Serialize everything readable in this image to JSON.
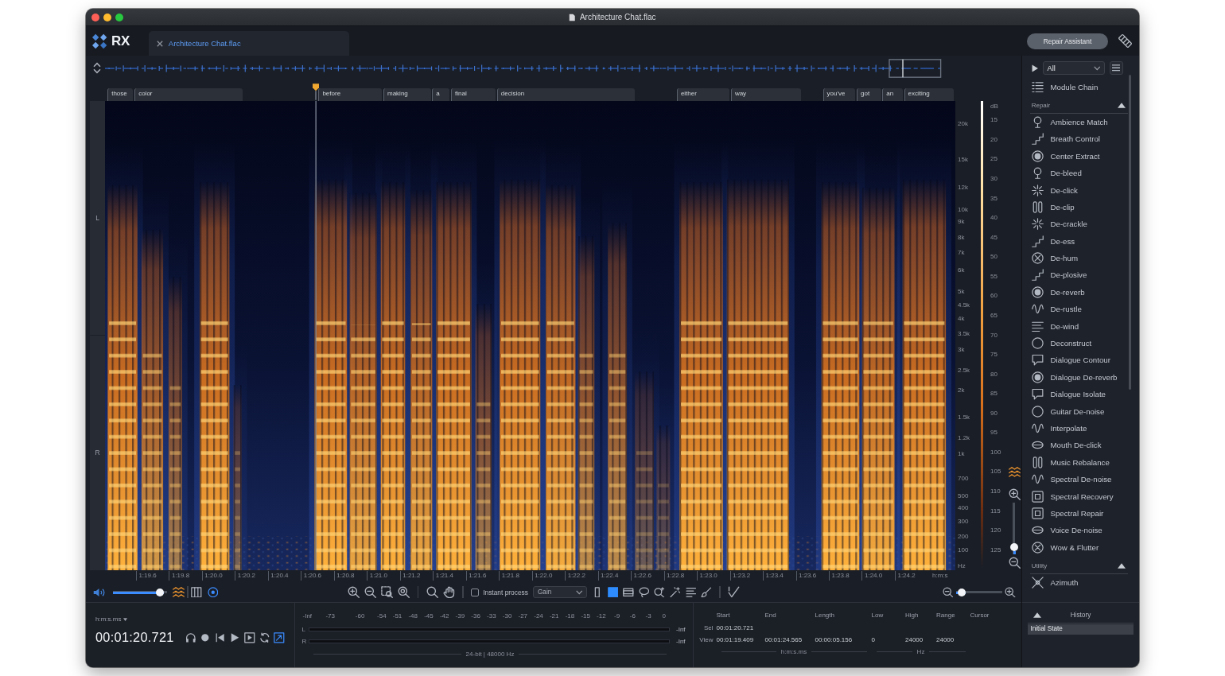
{
  "window": {
    "title": "Architecture Chat.flac"
  },
  "logo": "RX",
  "tabs": [
    {
      "label": "Architecture Chat.flac",
      "selected": true
    }
  ],
  "repair_assistant": "Repair Assistant",
  "transcript": [
    "those",
    "color",
    "before",
    "making",
    "a",
    "final",
    "decision",
    "either",
    "way",
    "you've",
    "got",
    "an",
    "exciting"
  ],
  "spectrogram": {
    "channels": [
      "L",
      "R"
    ],
    "frequency_labels": [
      "20k",
      "15k",
      "12k",
      "10k",
      "9k",
      "8k",
      "7k",
      "6k",
      "5k",
      "4.5k",
      "4k",
      "3.5k",
      "3k",
      "2.5k",
      "2k",
      "1.5k",
      "1.2k",
      "1k",
      "700",
      "500",
      "400",
      "300",
      "200",
      "100",
      "Hz"
    ],
    "db_labels": [
      "dB",
      "15",
      "20",
      "25",
      "30",
      "35",
      "40",
      "45",
      "50",
      "55",
      "60",
      "65",
      "70",
      "75",
      "80",
      "85",
      "90",
      "95",
      "100",
      "105",
      "110",
      "115",
      "120",
      "125"
    ],
    "time_labels": [
      "1:19.6",
      "1:19.8",
      "1:20.0",
      "1:20.2",
      "1:20.4",
      "1:20.6",
      "1:20.8",
      "1:21.0",
      "1:21.2",
      "1:21.4",
      "1:21.6",
      "1:21.8",
      "1:22.0",
      "1:22.2",
      "1:22.4",
      "1:22.6",
      "1:22.8",
      "1:23.0",
      "1:23.2",
      "1:23.4",
      "1:23.6",
      "1:23.8",
      "1:24.0",
      "1:24.2"
    ],
    "time_unit": "h:m:s",
    "vertical_zoom": {
      "level": 0.05
    }
  },
  "toolbar": {
    "volume": {
      "level": 0.95
    },
    "instant_process": {
      "label": "Instant process",
      "checked": false
    },
    "process_mode": "Gain",
    "tools": [
      {
        "kind": "time",
        "selected": false
      },
      {
        "kind": "time-frequency",
        "selected": true
      },
      {
        "kind": "frequency",
        "selected": false
      },
      {
        "kind": "lasso",
        "selected": false
      },
      {
        "kind": "find-similar",
        "selected": false
      },
      {
        "kind": "magic-wand",
        "selected": false
      },
      {
        "kind": "harmonic",
        "selected": false
      },
      {
        "kind": "brush",
        "selected": false
      }
    ],
    "zoom": {
      "level": 0.2
    }
  },
  "transport": {
    "time_format": "h:m:s.ms",
    "time": "00:01:20.721",
    "buttons": [
      {
        "kind": "monitor"
      },
      {
        "kind": "record"
      },
      {
        "kind": "previous"
      },
      {
        "kind": "play"
      },
      {
        "kind": "play-selection"
      },
      {
        "kind": "loop",
        "on": false
      },
      {
        "kind": "scroll",
        "on": true
      }
    ]
  },
  "meter": {
    "scale": [
      "-Inf",
      "-73",
      "-60",
      "-54",
      "-51",
      "-48",
      "-45",
      "-42",
      "-39",
      "-36",
      "-33",
      "-30",
      "-27",
      "-24",
      "-21",
      "-18",
      "-15",
      "-12",
      "-9",
      "-6",
      "-3",
      "0"
    ],
    "channels": [
      {
        "label": "L",
        "peak": "-Inf"
      },
      {
        "label": "R",
        "peak": "-Inf"
      }
    ],
    "format": "24-bit | 48000 Hz"
  },
  "selection": {
    "columns": [
      "Start",
      "End",
      "Length",
      "Low",
      "High",
      "Range",
      "Cursor"
    ],
    "rows": [
      {
        "label": "Sel",
        "values": [
          "00:01:20.721"
        ]
      },
      {
        "label": "View",
        "values": [
          "00:01:19.409",
          "00:01:24.565",
          "00:00:05.156",
          "0",
          "24000",
          "24000"
        ]
      }
    ],
    "time_unit": "h:m:s.ms",
    "frequency_unit": "Hz"
  },
  "module_panel": {
    "filter": "All",
    "module_chain": "Module Chain",
    "sections": [
      {
        "title": "Repair",
        "expanded": true,
        "items": [
          "Ambience Match",
          "Breath Control",
          "Center Extract",
          "De-bleed",
          "De-click",
          "De-clip",
          "De-crackle",
          "De-ess",
          "De-hum",
          "De-plosive",
          "De-reverb",
          "De-rustle",
          "De-wind",
          "Deconstruct",
          "Dialogue Contour",
          "Dialogue De-reverb",
          "Dialogue Isolate",
          "Guitar De-noise",
          "Interpolate",
          "Mouth De-click",
          "Music Rebalance",
          "Spectral De-noise",
          "Spectral Recovery",
          "Spectral Repair",
          "Voice De-noise",
          "Wow & Flutter"
        ]
      },
      {
        "title": "Utility",
        "expanded": true,
        "items": [
          "Azimuth"
        ]
      }
    ]
  },
  "history": {
    "title": "History",
    "expanded": true,
    "items": [
      {
        "label": "Initial State",
        "selected": true
      }
    ]
  }
}
